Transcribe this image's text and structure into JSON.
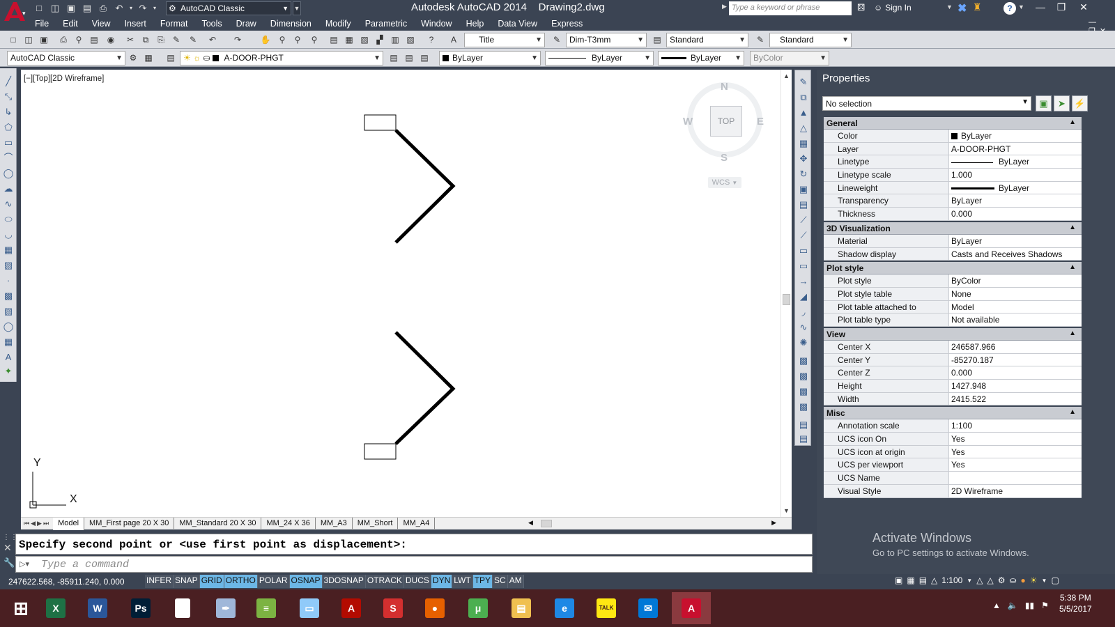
{
  "titlebar": {
    "app_title": "Autodesk AutoCAD 2014",
    "doc_title": "Drawing2.dwg",
    "workspace": "AutoCAD Classic",
    "search_placeholder": "Type a keyword or phrase",
    "sign_in": "Sign In",
    "help": "?"
  },
  "menu": [
    "File",
    "Edit",
    "View",
    "Insert",
    "Format",
    "Tools",
    "Draw",
    "Dimension",
    "Modify",
    "Parametric",
    "Window",
    "Help",
    "Data View",
    "Express"
  ],
  "toolbar1": {
    "text_style": "Title",
    "dim_style": "Dim-T3mm",
    "table_style": "Standard",
    "mleader_style": "Standard"
  },
  "toolbar2": {
    "workspace": "AutoCAD Classic",
    "layer": "A-DOOR-PHGT",
    "color": "ByLayer",
    "linetype": "ByLayer",
    "lineweight": "ByLayer",
    "plotstyle": "ByColor"
  },
  "viewport": {
    "label": "[−][Top][2D Wireframe]",
    "viewcube_top": "TOP",
    "compass": {
      "n": "N",
      "s": "S",
      "e": "E",
      "w": "W"
    },
    "wcs": "WCS",
    "ucs_x": "X",
    "ucs_y": "Y"
  },
  "layout_tabs": [
    "Model",
    "MM_First page 20 X 30",
    "MM_Standard 20 X 30",
    "MM_24 X 36",
    "MM_A3",
    "MM_Short",
    "MM_A4"
  ],
  "properties": {
    "title": "Properties",
    "selection": "No selection",
    "sections": [
      {
        "name": "General",
        "rows": [
          {
            "key": "Color",
            "value": "ByLayer",
            "swatch": "#000000"
          },
          {
            "key": "Layer",
            "value": "A-DOOR-PHGT"
          },
          {
            "key": "Linetype",
            "value": "ByLayer",
            "linetype": true
          },
          {
            "key": "Linetype scale",
            "value": "1.000"
          },
          {
            "key": "Lineweight",
            "value": "ByLayer",
            "lineweight": true
          },
          {
            "key": "Transparency",
            "value": "ByLayer"
          },
          {
            "key": "Thickness",
            "value": "0.000"
          }
        ]
      },
      {
        "name": "3D Visualization",
        "rows": [
          {
            "key": "Material",
            "value": "ByLayer"
          },
          {
            "key": "Shadow display",
            "value": "Casts and Receives Shadows"
          }
        ]
      },
      {
        "name": "Plot style",
        "rows": [
          {
            "key": "Plot style",
            "value": "ByColor"
          },
          {
            "key": "Plot style table",
            "value": "None"
          },
          {
            "key": "Plot table attached to",
            "value": "Model"
          },
          {
            "key": "Plot table type",
            "value": "Not available"
          }
        ]
      },
      {
        "name": "View",
        "rows": [
          {
            "key": "Center X",
            "value": "246587.966"
          },
          {
            "key": "Center Y",
            "value": "-85270.187"
          },
          {
            "key": "Center Z",
            "value": "0.000"
          },
          {
            "key": "Height",
            "value": "1427.948"
          },
          {
            "key": "Width",
            "value": "2415.522"
          }
        ]
      },
      {
        "name": "Misc",
        "rows": [
          {
            "key": "Annotation scale",
            "value": "1:100"
          },
          {
            "key": "UCS icon On",
            "value": "Yes"
          },
          {
            "key": "UCS icon at origin",
            "value": "Yes"
          },
          {
            "key": "UCS per viewport",
            "value": "Yes"
          },
          {
            "key": "UCS Name",
            "value": ""
          },
          {
            "key": "Visual Style",
            "value": "2D Wireframe"
          }
        ]
      }
    ]
  },
  "watermark": {
    "title": "Activate Windows",
    "subtitle": "Go to PC settings to activate Windows."
  },
  "command": {
    "history": "Specify second point or <use first point as displacement>:",
    "placeholder": "Type a command"
  },
  "statusbar": {
    "coords": "247622.568, -85911.240, 0.000",
    "toggles": [
      {
        "label": "INFER",
        "on": false
      },
      {
        "label": "SNAP",
        "on": false
      },
      {
        "label": "GRID",
        "on": true
      },
      {
        "label": "ORTHO",
        "on": true
      },
      {
        "label": "POLAR",
        "on": false
      },
      {
        "label": "OSNAP",
        "on": true
      },
      {
        "label": "3DOSNAP",
        "on": false
      },
      {
        "label": "OTRACK",
        "on": false
      },
      {
        "label": "DUCS",
        "on": false
      },
      {
        "label": "DYN",
        "on": true
      },
      {
        "label": "LWT",
        "on": false
      },
      {
        "label": "TPY",
        "on": true
      },
      {
        "label": "SC",
        "on": false
      },
      {
        "label": "AM",
        "on": false
      }
    ],
    "annotation_scale": "1:100"
  },
  "taskbar": {
    "apps": [
      {
        "name": "windows-start",
        "glyph": "⊞",
        "color": "#4a1f22"
      },
      {
        "name": "excel",
        "glyph": "X",
        "color": "#1e7145"
      },
      {
        "name": "word",
        "glyph": "W",
        "color": "#2b579a"
      },
      {
        "name": "photoshop",
        "glyph": "Ps",
        "color": "#001e36"
      },
      {
        "name": "blank-document",
        "glyph": "",
        "color": "#ffffff"
      },
      {
        "name": "sketch-app",
        "glyph": "✒",
        "color": "#9fb7d9"
      },
      {
        "name": "project-app",
        "glyph": "≡",
        "color": "#7cb342"
      },
      {
        "name": "eraser-app",
        "glyph": "▭",
        "color": "#90caf9"
      },
      {
        "name": "acrobat",
        "glyph": "A",
        "color": "#b30b00"
      },
      {
        "name": "sketchup",
        "glyph": "S",
        "color": "#d32f2f"
      },
      {
        "name": "firefox",
        "glyph": "●",
        "color": "#e66000"
      },
      {
        "name": "utorrent",
        "glyph": "μ",
        "color": "#4caf50"
      },
      {
        "name": "file-explorer",
        "glyph": "▤",
        "color": "#f0c050"
      },
      {
        "name": "internet-explorer",
        "glyph": "e",
        "color": "#1e88e5"
      },
      {
        "name": "kakaotalk",
        "glyph": "TALK",
        "color": "#ffe812"
      },
      {
        "name": "mail",
        "glyph": "✉",
        "color": "#0078d7"
      },
      {
        "name": "autocad",
        "glyph": "A",
        "color": "#c8102e"
      }
    ],
    "time": "5:38 PM",
    "date": "5/5/2017"
  },
  "colors": {
    "accent": "#3b4453",
    "taskbar": "#4a1f22",
    "toggle_on": "#6cb7e6",
    "autocad_red": "#c8102e"
  }
}
